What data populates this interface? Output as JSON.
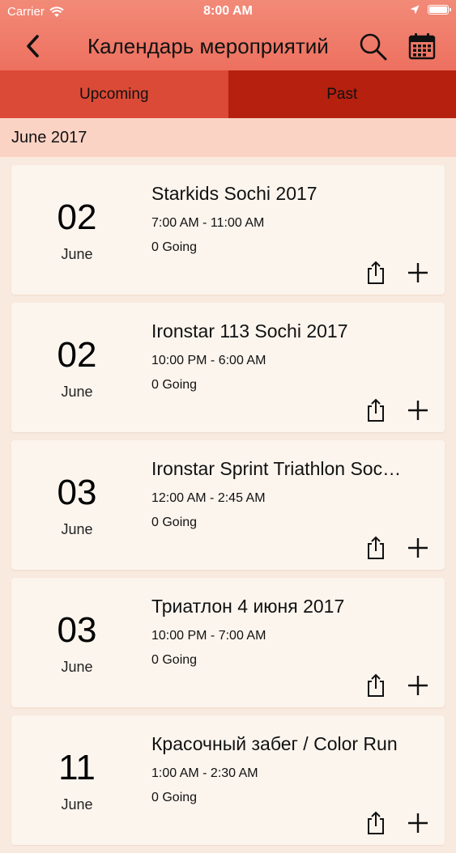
{
  "status_bar": {
    "carrier": "Carrier",
    "time": "8:00 AM",
    "icons": [
      "wifi-icon",
      "location-arrow-icon",
      "battery-icon"
    ]
  },
  "nav": {
    "title": "Календарь мероприятий",
    "back_icon": "chevron-left-icon",
    "search_icon": "search-icon",
    "calendar_icon": "calendar-icon"
  },
  "tabs": [
    {
      "label": "Upcoming",
      "selected": true
    },
    {
      "label": "Past",
      "selected": false
    }
  ],
  "section": {
    "title": "June 2017"
  },
  "events": [
    {
      "day": "02",
      "month": "June",
      "title": "Starkids Sochi 2017",
      "time": "7:00 AM - 11:00 AM",
      "going": "0 Going"
    },
    {
      "day": "02",
      "month": "June",
      "title": "Ironstar 113 Sochi 2017",
      "time": "10:00 PM - 6:00 AM",
      "going": "0 Going"
    },
    {
      "day": "03",
      "month": "June",
      "title": "Ironstar Sprint Triathlon Soc…",
      "time": "12:00 AM - 2:45 AM",
      "going": "0 Going"
    },
    {
      "day": "03",
      "month": "June",
      "title": "Триатлон 4 июня 2017",
      "time": "10:00 PM - 7:00 AM",
      "going": "0 Going"
    },
    {
      "day": "11",
      "month": "June",
      "title": "Красочный забег / Color Run",
      "time": "1:00 AM - 2:30 AM",
      "going": "0 Going"
    }
  ],
  "colors": {
    "header": "#ee705f",
    "tab_upcoming": "#db4a36",
    "tab_past": "#b5200f",
    "section_header": "#fbd3c5",
    "background": "#f9eadf",
    "card": "#fcf5ee"
  }
}
